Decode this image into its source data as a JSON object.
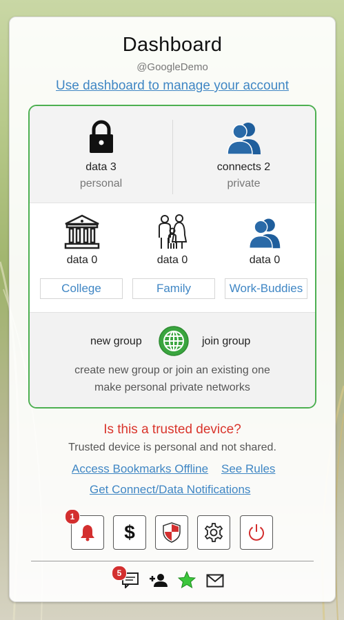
{
  "header": {
    "title": "Dashboard",
    "handle": "@GoogleDemo",
    "manage_link": "Use dashboard to manage your account"
  },
  "stats": [
    {
      "icon": "lock-icon",
      "label": "data 3",
      "sub": "personal"
    },
    {
      "icon": "people-icon",
      "label": "connects 2",
      "sub": "private"
    }
  ],
  "groups": [
    {
      "icon": "institution-icon",
      "count": "data 0",
      "name": "College"
    },
    {
      "icon": "family-icon",
      "count": "data 0",
      "name": "Family"
    },
    {
      "icon": "people-icon",
      "count": "data 0",
      "name": "Work-Buddies"
    }
  ],
  "group_actions": {
    "new_group": "new group",
    "join_group": "join group",
    "desc_line1": "create new group or join an existing one",
    "desc_line2": "make personal private networks"
  },
  "trusted": {
    "question": "Is this a trusted device?",
    "text": "Trusted device is personal and not shared.",
    "link_bookmarks": "Access Bookmarks Offline",
    "link_rules": "See Rules",
    "link_notifications": "Get Connect/Data Notifications"
  },
  "toolbar": {
    "notification_badge": "1",
    "dollar_symbol": "$"
  },
  "bottom_bar": {
    "messages_badge": "5"
  },
  "colors": {
    "accent_green": "#4caf50",
    "link_blue": "#3f86c4",
    "alert_red": "#d9342b",
    "icon_blue": "#2a6aa8"
  }
}
